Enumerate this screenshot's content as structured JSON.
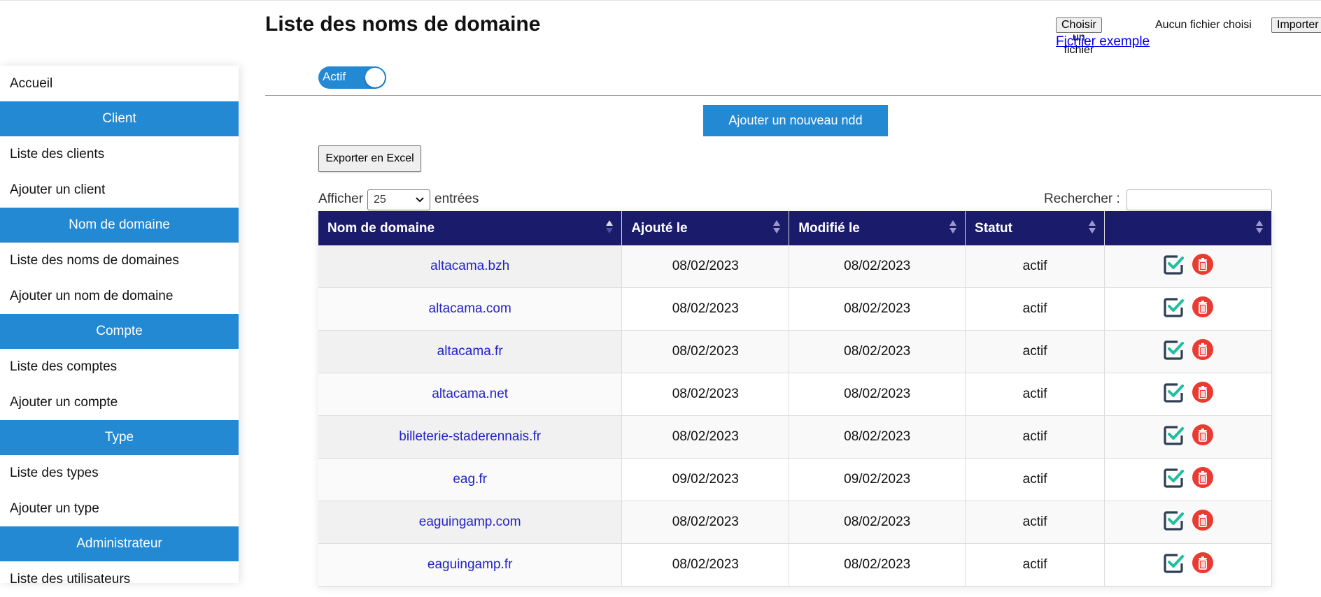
{
  "page": {
    "title": "Liste des noms de domaine"
  },
  "file_upload": {
    "choose_label": "Choisir un fichier",
    "status": "Aucun fichier choisi",
    "import_label": "Importer",
    "example_link": "Fichier exemple"
  },
  "toggle": {
    "label": "Actif",
    "on": true
  },
  "actions": {
    "add_label": "Ajouter un nouveau ndd",
    "export_label": "Exporter en Excel"
  },
  "length": {
    "prefix": "Afficher",
    "value": "25",
    "suffix": "entrées"
  },
  "search": {
    "label": "Rechercher :",
    "value": ""
  },
  "sidebar": {
    "items": [
      {
        "type": "link",
        "label": "Accueil"
      },
      {
        "type": "header",
        "label": "Client"
      },
      {
        "type": "link",
        "label": "Liste des clients"
      },
      {
        "type": "link",
        "label": "Ajouter un client"
      },
      {
        "type": "header",
        "label": "Nom de domaine"
      },
      {
        "type": "link",
        "label": "Liste des noms de domaines"
      },
      {
        "type": "link",
        "label": "Ajouter un nom de domaine"
      },
      {
        "type": "header",
        "label": "Compte"
      },
      {
        "type": "link",
        "label": "Liste des comptes"
      },
      {
        "type": "link",
        "label": "Ajouter un compte"
      },
      {
        "type": "header",
        "label": "Type"
      },
      {
        "type": "link",
        "label": "Liste des types"
      },
      {
        "type": "link",
        "label": "Ajouter un type"
      },
      {
        "type": "header",
        "label": "Administrateur"
      },
      {
        "type": "link",
        "label": "Liste des utilisateurs"
      }
    ]
  },
  "table": {
    "columns": [
      "Nom de domaine",
      "Ajouté le",
      "Modifié le",
      "Statut",
      ""
    ],
    "rows": [
      {
        "domain": "altacama.bzh",
        "added": "08/02/2023",
        "modified": "08/02/2023",
        "status": "actif"
      },
      {
        "domain": "altacama.com",
        "added": "08/02/2023",
        "modified": "08/02/2023",
        "status": "actif"
      },
      {
        "domain": "altacama.fr",
        "added": "08/02/2023",
        "modified": "08/02/2023",
        "status": "actif"
      },
      {
        "domain": "altacama.net",
        "added": "08/02/2023",
        "modified": "08/02/2023",
        "status": "actif"
      },
      {
        "domain": "billeterie-staderennais.fr",
        "added": "08/02/2023",
        "modified": "08/02/2023",
        "status": "actif"
      },
      {
        "domain": "eag.fr",
        "added": "09/02/2023",
        "modified": "09/02/2023",
        "status": "actif"
      },
      {
        "domain": "eaguingamp.com",
        "added": "08/02/2023",
        "modified": "08/02/2023",
        "status": "actif"
      },
      {
        "domain": "eaguingamp.fr",
        "added": "08/02/2023",
        "modified": "08/02/2023",
        "status": "actif"
      }
    ]
  },
  "icons": {
    "edit": "check-square-icon",
    "delete": "trash-icon"
  },
  "colors": {
    "primary": "#2389d3",
    "table_header": "#1b1b6b",
    "delete": "#ea3b33",
    "check": "#1fbf9f"
  }
}
